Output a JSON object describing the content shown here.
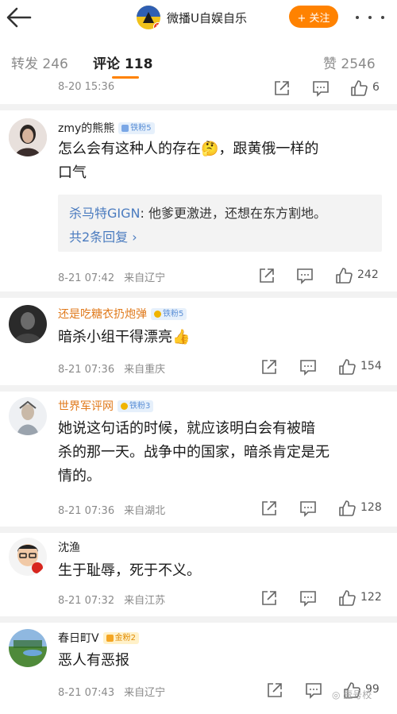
{
  "header": {
    "back_icon": "back-arrow-icon",
    "channel_name": "微播U自娱自乐",
    "follow_label": "+ 关注",
    "more_icon": "more-dots-icon"
  },
  "tabs": [
    {
      "label": "转发 246"
    },
    {
      "label": "评论 118"
    },
    {
      "label": "赞 2546"
    }
  ],
  "top_partial": {
    "time": "8-20 15:36",
    "likes": "6"
  },
  "comments": [
    {
      "user": "zmy的熊熊",
      "badge": "铁粉5",
      "text_lines": [
        "怎么会有这种人的存在🤔，跟黄俄一样的",
        "口气"
      ],
      "reply": {
        "user": "杀马特GIGN",
        "text": ": 他爹更激进，还想在东方割地。",
        "more": "共2条回复 ›"
      },
      "time": "8-21 07:42",
      "location": "来自辽宁",
      "likes": "242"
    },
    {
      "user": "还是吃糖衣扔炮弹",
      "badge": "铁粉5",
      "text_lines": [
        "暗杀小组干得漂亮👍"
      ],
      "time": "8-21 07:36",
      "location": "来自重庆",
      "likes": "154"
    },
    {
      "user": "世界军评网",
      "badge": "铁粉3",
      "text_lines": [
        "她说这句话的时候，就应该明白会有被暗",
        "杀的那一天。战争中的国家，暗杀肯定是无",
        "情的。"
      ],
      "time": "8-21 07:36",
      "location": "来自湖北",
      "likes": "128"
    },
    {
      "user": "沈渔",
      "text_lines": [
        "生于耻辱，死于不义。"
      ],
      "time": "8-21 07:32",
      "location": "来自江苏",
      "likes": "122"
    },
    {
      "user": "春日町V",
      "badge": "金粉2",
      "text_lines": [
        "恶人有恶报"
      ],
      "time": "8-21 07:43",
      "location": "来自辽宁",
      "likes": "99"
    }
  ],
  "watermark": "壹号校",
  "colors": {
    "accent": "#ff8200",
    "link": "#4a7bbf",
    "muted": "#8a8a8a"
  }
}
